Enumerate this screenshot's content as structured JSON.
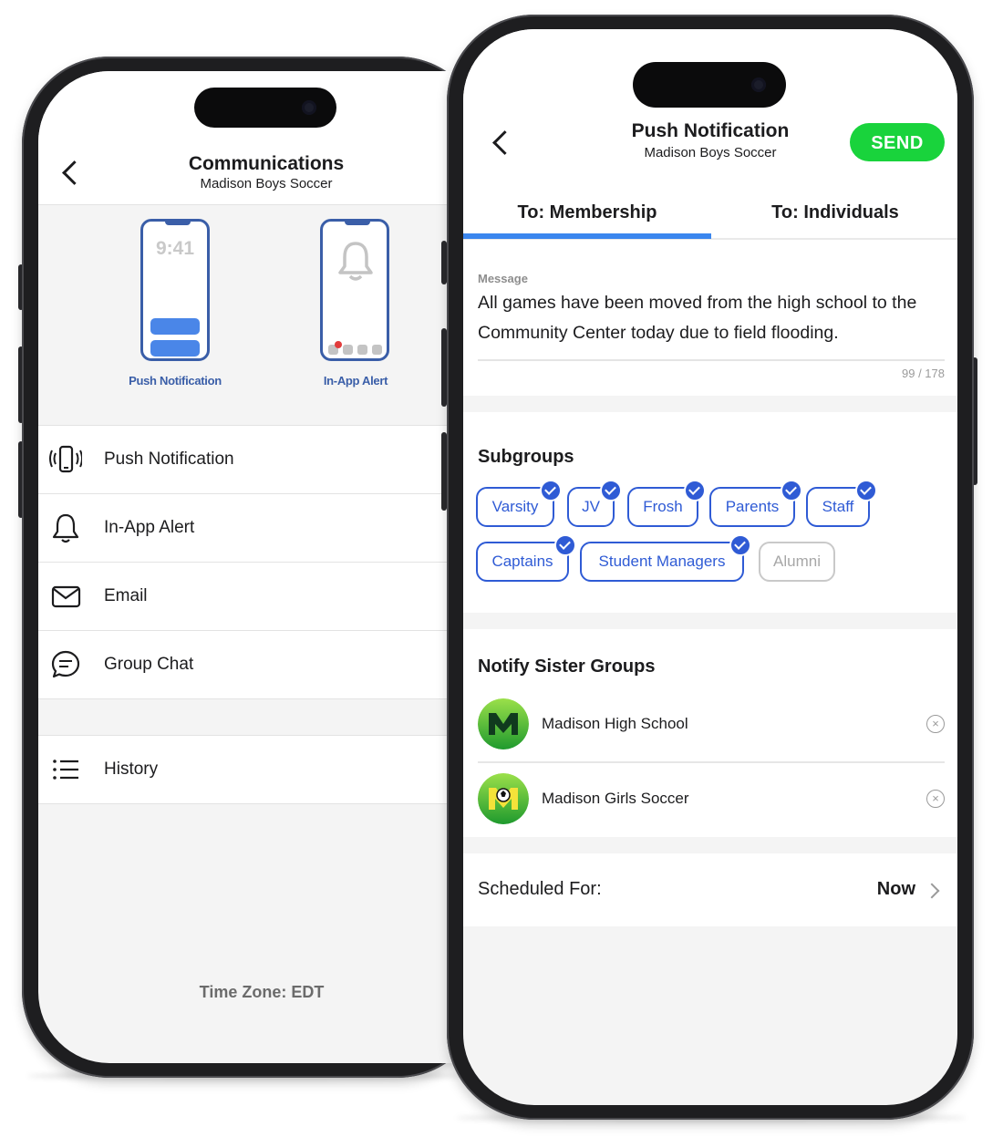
{
  "left": {
    "header": {
      "title": "Communications",
      "subtitle": "Madison Boys Soccer"
    },
    "illustrations": {
      "push": {
        "clock": "9:41",
        "label": "Push Notification"
      },
      "alert": {
        "label": "In-App Alert"
      }
    },
    "menu": [
      {
        "label": "Push Notification",
        "icon": "vibrating-phone-icon"
      },
      {
        "label": "In-App Alert",
        "icon": "bell-icon"
      },
      {
        "label": "Email",
        "icon": "envelope-icon"
      },
      {
        "label": "Group Chat",
        "icon": "chat-bubble-icon"
      }
    ],
    "history": {
      "label": "History",
      "icon": "list-icon"
    },
    "timezone": "Time Zone: EDT"
  },
  "right": {
    "header": {
      "title": "Push Notification",
      "subtitle": "Madison Boys Soccer",
      "send_label": "SEND"
    },
    "tabs": [
      {
        "label": "To: Membership",
        "active": true
      },
      {
        "label": "To: Individuals",
        "active": false
      }
    ],
    "message": {
      "label": "Message",
      "text": "All games have been moved from the high school to the Community Center today due to field flooding.",
      "count": "99 / 178"
    },
    "subgroups": {
      "title": "Subgroups",
      "chips": [
        {
          "label": "Varsity",
          "selected": true
        },
        {
          "label": "JV",
          "selected": true
        },
        {
          "label": "Frosh",
          "selected": true
        },
        {
          "label": "Parents",
          "selected": true
        },
        {
          "label": "Staff",
          "selected": true
        },
        {
          "label": "Captains",
          "selected": true
        },
        {
          "label": "Student Managers",
          "selected": true
        },
        {
          "label": "Alumni",
          "selected": false
        }
      ]
    },
    "sister_groups": {
      "title": "Notify Sister Groups",
      "items": [
        {
          "name": "Madison High School"
        },
        {
          "name": "Madison Girls Soccer"
        }
      ]
    },
    "schedule": {
      "label": "Scheduled For:",
      "value": "Now"
    }
  },
  "colors": {
    "accent_blue": "#2f5bd5",
    "tab_blue": "#3b86ee",
    "send_green": "#19d33c",
    "illustration_blue": "#3a5ea8"
  }
}
